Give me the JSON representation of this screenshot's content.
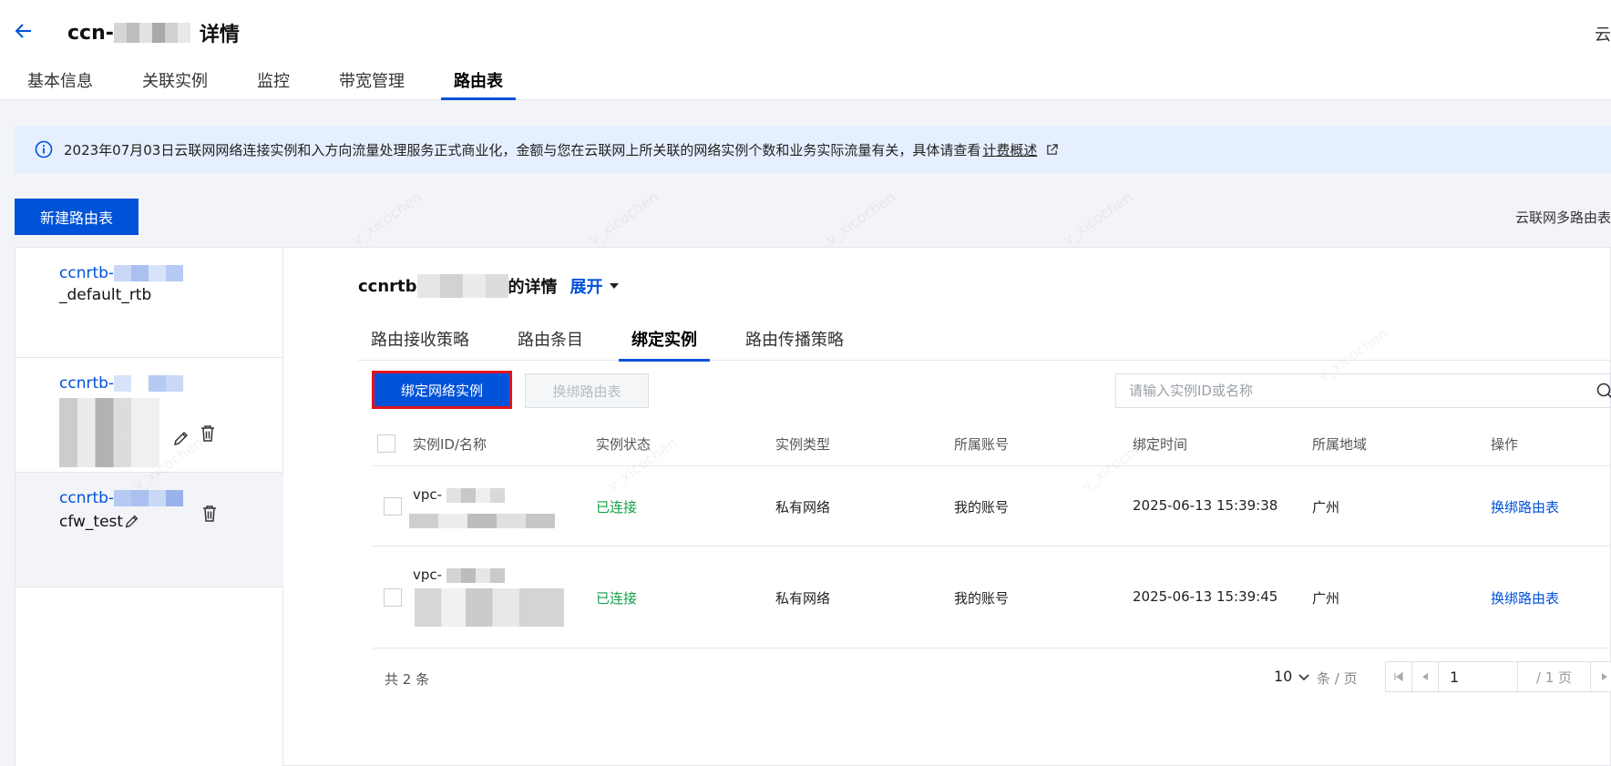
{
  "header": {
    "title_prefix": "ccn-",
    "title_suffix": "详情",
    "corner_text": "云",
    "tabs": [
      {
        "label": "基本信息"
      },
      {
        "label": "关联实例"
      },
      {
        "label": "监控"
      },
      {
        "label": "带宽管理"
      },
      {
        "label": "路由表"
      }
    ]
  },
  "notice": {
    "text": "2023年07月03日云联网网络连接实例和入方向流量处理服务正式商业化，金额与您在云联网上所关联的网络实例个数和业务实际流量有关，具体请查看",
    "link": "计费概述"
  },
  "actions": {
    "new_route_table": "新建路由表",
    "multi_route_table": "云联网多路由表"
  },
  "route_tables": [
    {
      "id_prefix": "ccnrtb-",
      "name": "_default_rtb"
    },
    {
      "id_prefix": "ccnrtb-",
      "name": ""
    },
    {
      "id_prefix": "ccnrtb-",
      "name": "cfw_test"
    }
  ],
  "detail": {
    "title_prefix": "ccnrtb",
    "title_suffix": "的详情",
    "expand": "展开",
    "tabs": [
      {
        "label": "路由接收策略"
      },
      {
        "label": "路由条目"
      },
      {
        "label": "绑定实例"
      },
      {
        "label": "路由传播策略"
      }
    ],
    "bind_button": "绑定网络实例",
    "rebind_button": "换绑路由表",
    "search_placeholder": "请输入实例ID或名称"
  },
  "table": {
    "columns": [
      "实例ID/名称",
      "实例状态",
      "实例类型",
      "所属账号",
      "绑定时间",
      "所属地域",
      "操作"
    ],
    "rows": [
      {
        "id_prefix": "vpc-",
        "status": "已连接",
        "type": "私有网络",
        "account": "我的账号",
        "bind_time": "2025-06-13 15:39:38",
        "region": "广州",
        "action": "换绑路由表"
      },
      {
        "id_prefix": "vpc-",
        "status": "已连接",
        "type": "私有网络",
        "account": "我的账号",
        "bind_time": "2025-06-13 15:39:45",
        "region": "广州",
        "action": "换绑路由表"
      }
    ]
  },
  "pagination": {
    "total": "共 2 条",
    "page_size": "10",
    "per_page": "条 / 页",
    "current": "1",
    "total_pages": "/ 1 页"
  },
  "watermark": "v_xicochen",
  "colors": {
    "primary": "#0052d9",
    "success": "#15a04a",
    "highlight_border": "#e3141d"
  }
}
